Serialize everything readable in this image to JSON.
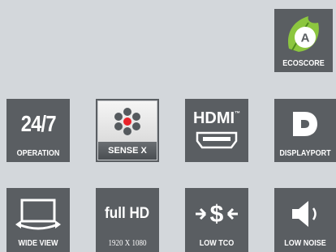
{
  "ecoscore": {
    "grade": "A",
    "label": "ECOSCORE",
    "leaf_color": "#8cc63f"
  },
  "features": {
    "operation": {
      "big": "24/7",
      "label": "OPERATION"
    },
    "sense": {
      "label": "SENSE X",
      "accent_color": "#e8232a"
    },
    "hdmi": {
      "big": "HDMI",
      "tm": "™",
      "label": ""
    },
    "displayport": {
      "label": "DISPLAYPORT"
    },
    "wide_view": {
      "label": "WIDE VIEW"
    },
    "full_hd": {
      "big": "full HD",
      "label": "1920 X 1080"
    },
    "low_tco": {
      "label": "LOW TCO"
    },
    "low_noise": {
      "label": "LOW NOISE"
    }
  },
  "colors": {
    "tile": "#5a5e62",
    "background": "#d3d7db"
  }
}
